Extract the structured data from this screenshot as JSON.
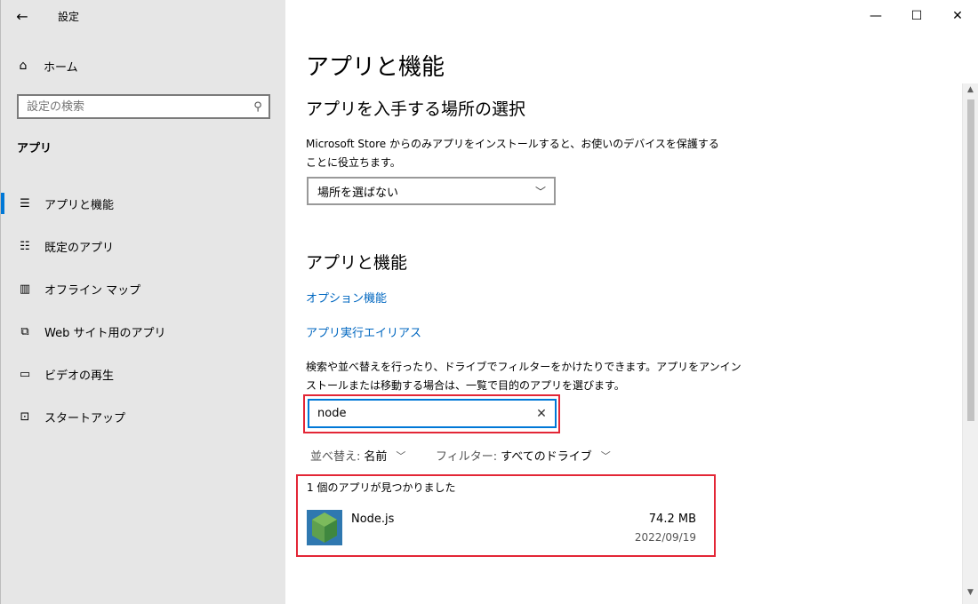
{
  "window": {
    "title": "設定",
    "controls": {
      "minimize": "—",
      "maximize": "☐",
      "close": "✕"
    }
  },
  "sidebar": {
    "back": "←",
    "home_label": "ホーム",
    "search_placeholder": "設定の検索",
    "section_title": "アプリ",
    "items": [
      {
        "label": "アプリと機能",
        "icon": "apps-features-icon",
        "active": true
      },
      {
        "label": "既定のアプリ",
        "icon": "default-apps-icon",
        "active": false
      },
      {
        "label": "オフライン マップ",
        "icon": "offline-maps-icon",
        "active": false
      },
      {
        "label": "Web サイト用のアプリ",
        "icon": "apps-for-websites-icon",
        "active": false
      },
      {
        "label": "ビデオの再生",
        "icon": "video-playback-icon",
        "active": false
      },
      {
        "label": "スタートアップ",
        "icon": "startup-icon",
        "active": false
      }
    ]
  },
  "main": {
    "page_title": "アプリと機能",
    "install_section": {
      "title": "アプリを入手する場所の選択",
      "description_line1": "Microsoft Store からのみアプリをインストールすると、お使いのデバイスを保護する",
      "description_line2": "ことに役立ちます。",
      "dropdown_value": "場所を選ばない"
    },
    "apps_section": {
      "title": "アプリと機能",
      "link_optional": "オプション機能",
      "link_alias": "アプリ実行エイリアス",
      "description_line1": "検索や並べ替えを行ったり、ドライブでフィルターをかけたりできます。アプリをアンイン",
      "description_line2": "ストールまたは移動する場合は、一覧で目的のアプリを選びます。",
      "search_value": "node",
      "sort_label": "並べ替え:",
      "sort_value": "名前",
      "filter_label": "フィルター:",
      "filter_value": "すべてのドライブ",
      "results_count": "1 個のアプリが見つかりました",
      "apps": [
        {
          "name": "Node.js",
          "size": "74.2 MB",
          "date": "2022/09/19"
        }
      ]
    }
  },
  "colors": {
    "accent": "#0078d7",
    "highlight_box": "#e32636",
    "link": "#0067c0"
  }
}
